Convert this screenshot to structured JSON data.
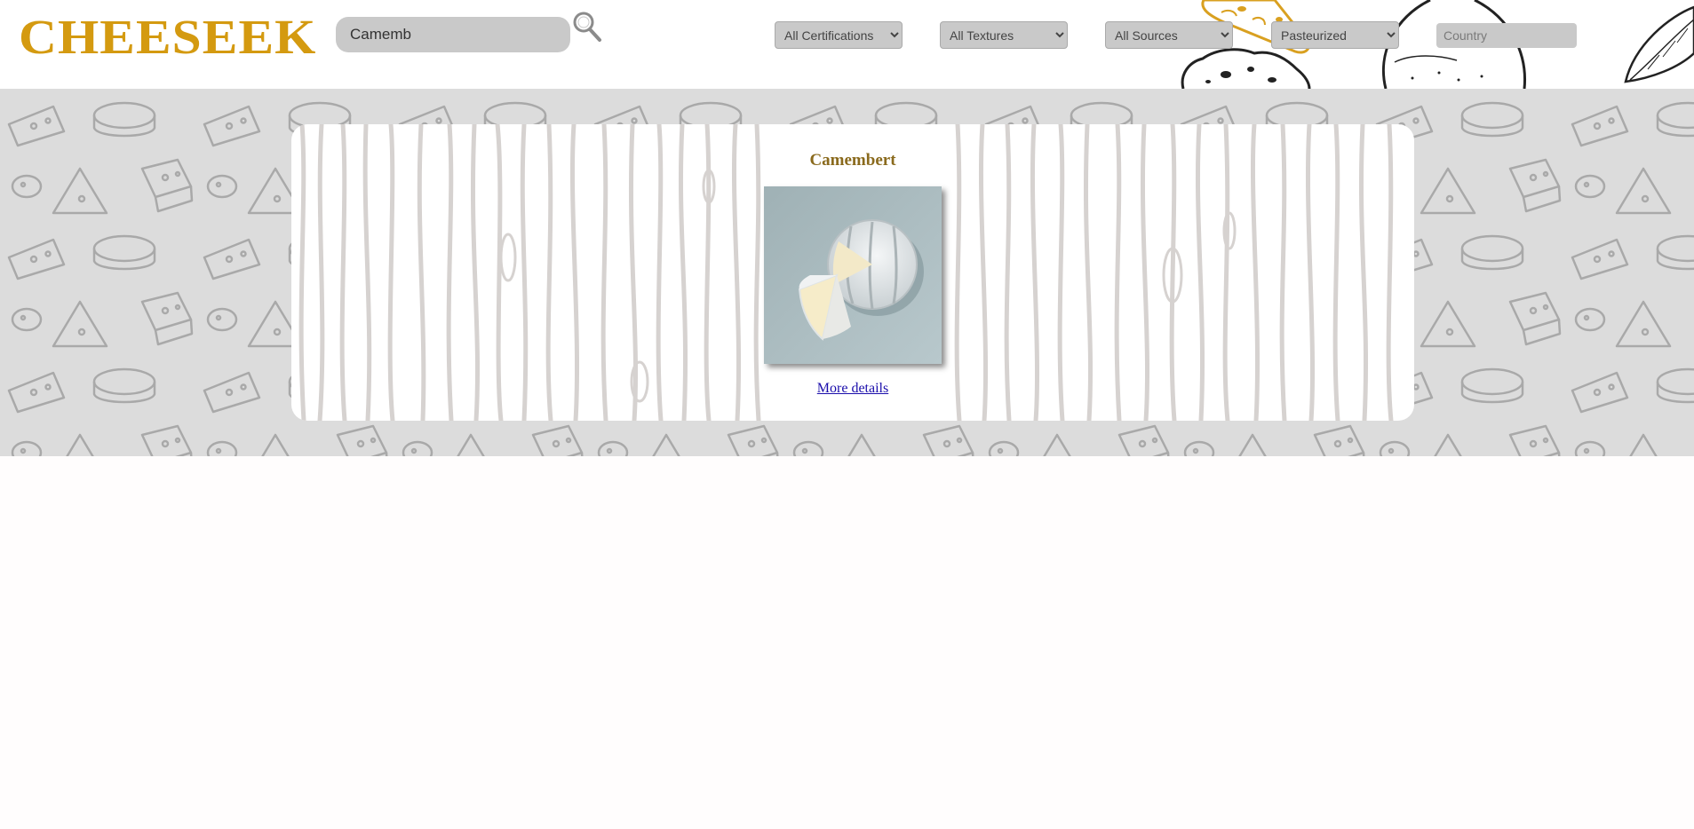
{
  "header": {
    "logo": "CHEESEEK",
    "search": {
      "value": "Camemb",
      "icon": "magnifier-icon"
    },
    "filters": {
      "certifications": "All Certifications",
      "textures": "All Textures",
      "sources": "All Sources",
      "pasteurization": "Pasteurized"
    },
    "country": {
      "placeholder": "Country"
    }
  },
  "results": [
    {
      "name": "Camembert",
      "link": "More details"
    }
  ],
  "colors": {
    "brand": "#d49a10",
    "title": "#8a6a1d",
    "link": "#1a0dab",
    "pattern_bg": "#dcdcdc",
    "field_bg": "#c9c9c9"
  }
}
